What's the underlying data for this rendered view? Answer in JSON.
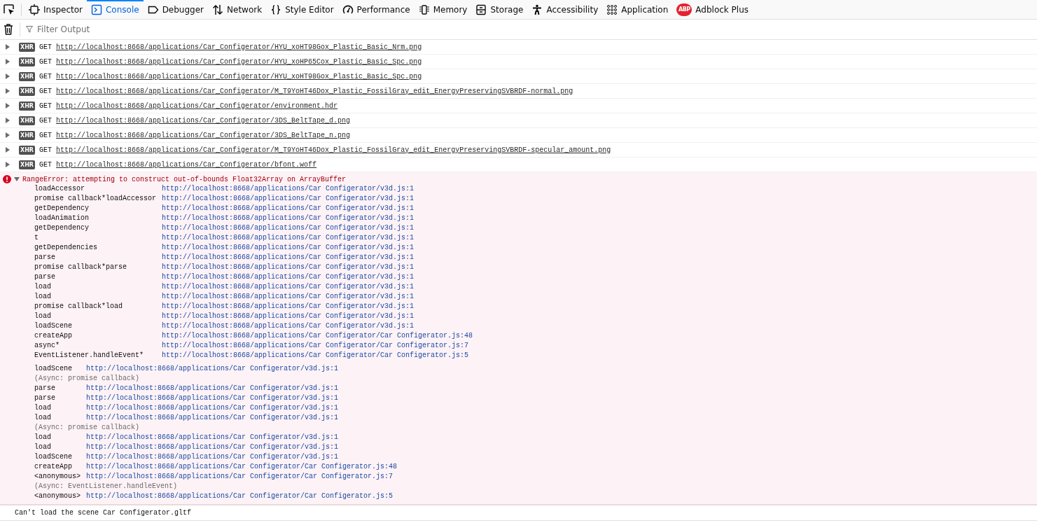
{
  "toolbar": {
    "tools": [
      {
        "label": "Inspector",
        "selected": false
      },
      {
        "label": "Console",
        "selected": true
      },
      {
        "label": "Debugger",
        "selected": false
      },
      {
        "label": "Network",
        "selected": false
      },
      {
        "label": "Style Editor",
        "selected": false
      },
      {
        "label": "Performance",
        "selected": false
      },
      {
        "label": "Memory",
        "selected": false
      },
      {
        "label": "Storage",
        "selected": false
      },
      {
        "label": "Accessibility",
        "selected": false
      },
      {
        "label": "Application",
        "selected": false
      },
      {
        "label": "Adblock Plus",
        "icon_text": "ABP",
        "selected": false
      }
    ]
  },
  "filter": {
    "placeholder": "Filter Output"
  },
  "messages": [
    {
      "kind": "request",
      "badge": "XHR",
      "method": "GET",
      "url": "http://localhost:8668/applications/Car_Configerator/HYU_xoHT98Gox_Plastic_Basic_Nrm.png"
    },
    {
      "kind": "request",
      "badge": "XHR",
      "method": "GET",
      "url": "http://localhost:8668/applications/Car_Configerator/HYU_xoHP65Cox_Plastic_Basic_Spc.png"
    },
    {
      "kind": "request",
      "badge": "XHR",
      "method": "GET",
      "url": "http://localhost:8668/applications/Car_Configerator/HYU_xoHT98Gox_Plastic_Basic_Spc.png"
    },
    {
      "kind": "request",
      "badge": "XHR",
      "method": "GET",
      "url": "http://localhost:8668/applications/Car_Configerator/M_T9YoHT46Dox_Plastic_FossilGray_edit_EnergyPreservingSVBRDF-normal.png"
    },
    {
      "kind": "request",
      "badge": "XHR",
      "method": "GET",
      "url": "http://localhost:8668/applications/Car_Configerator/environment.hdr"
    },
    {
      "kind": "request",
      "badge": "XHR",
      "method": "GET",
      "url": "http://localhost:8668/applications/Car_Configerator/3DS_BeltTape_d.png"
    },
    {
      "kind": "request",
      "badge": "XHR",
      "method": "GET",
      "url": "http://localhost:8668/applications/Car_Configerator/3DS_BeltTape_n.png"
    },
    {
      "kind": "request",
      "badge": "XHR",
      "method": "GET",
      "url": "http://localhost:8668/applications/Car_Configerator/M_T9YoHT46Dox_Plastic_FossilGray_edit_EnergyPreservingSVBRDF-specular_amount.png"
    },
    {
      "kind": "request",
      "badge": "XHR",
      "method": "GET",
      "url": "http://localhost:8668/applications/Car_Configerator/bfont.woff"
    },
    {
      "kind": "error",
      "expanded": true,
      "text": "RangeError: attempting to construct out-of-bounds Float32Array on ArrayBuffer",
      "stacks": [
        [
          {
            "kind": "frame",
            "fn": "loadAccessor",
            "src": "http://localhost:8668/applications/Car Configerator/v3d.js:1"
          },
          {
            "kind": "frame",
            "fn": "promise callback*loadAccessor",
            "src": "http://localhost:8668/applications/Car Configerator/v3d.js:1"
          },
          {
            "kind": "frame",
            "fn": "getDependency",
            "src": "http://localhost:8668/applications/Car Configerator/v3d.js:1"
          },
          {
            "kind": "frame",
            "fn": "loadAnimation",
            "src": "http://localhost:8668/applications/Car Configerator/v3d.js:1"
          },
          {
            "kind": "frame",
            "fn": "getDependency",
            "src": "http://localhost:8668/applications/Car Configerator/v3d.js:1"
          },
          {
            "kind": "frame",
            "fn": "t",
            "src": "http://localhost:8668/applications/Car Configerator/v3d.js:1"
          },
          {
            "kind": "frame",
            "fn": "getDependencies",
            "src": "http://localhost:8668/applications/Car Configerator/v3d.js:1"
          },
          {
            "kind": "frame",
            "fn": "parse",
            "src": "http://localhost:8668/applications/Car Configerator/v3d.js:1"
          },
          {
            "kind": "frame",
            "fn": "promise callback*parse",
            "src": "http://localhost:8668/applications/Car Configerator/v3d.js:1"
          },
          {
            "kind": "frame",
            "fn": "parse",
            "src": "http://localhost:8668/applications/Car Configerator/v3d.js:1"
          },
          {
            "kind": "frame",
            "fn": "load",
            "src": "http://localhost:8668/applications/Car Configerator/v3d.js:1"
          },
          {
            "kind": "frame",
            "fn": "load",
            "src": "http://localhost:8668/applications/Car Configerator/v3d.js:1"
          },
          {
            "kind": "frame",
            "fn": "promise callback*load",
            "src": "http://localhost:8668/applications/Car Configerator/v3d.js:1"
          },
          {
            "kind": "frame",
            "fn": "load",
            "src": "http://localhost:8668/applications/Car Configerator/v3d.js:1"
          },
          {
            "kind": "frame",
            "fn": "loadScene",
            "src": "http://localhost:8668/applications/Car Configerator/v3d.js:1"
          },
          {
            "kind": "frame",
            "fn": "createApp",
            "src": "http://localhost:8668/applications/Car Configerator/Car Configerator.js:48"
          },
          {
            "kind": "frame",
            "fn": "async*",
            "src": "http://localhost:8668/applications/Car Configerator/Car Configerator.js:7"
          },
          {
            "kind": "frame",
            "fn": "EventListener.handleEvent*",
            "src": "http://localhost:8668/applications/Car Configerator/Car Configerator.js:5"
          }
        ],
        [
          {
            "kind": "frame",
            "fn": "loadScene",
            "src": "http://localhost:8668/applications/Car Configerator/v3d.js:1"
          },
          {
            "kind": "async",
            "text": "(Async: promise callback)"
          },
          {
            "kind": "frame",
            "fn": "parse",
            "src": "http://localhost:8668/applications/Car Configerator/v3d.js:1"
          },
          {
            "kind": "frame",
            "fn": "parse",
            "src": "http://localhost:8668/applications/Car Configerator/v3d.js:1"
          },
          {
            "kind": "frame",
            "fn": "load",
            "src": "http://localhost:8668/applications/Car Configerator/v3d.js:1"
          },
          {
            "kind": "frame",
            "fn": "load",
            "src": "http://localhost:8668/applications/Car Configerator/v3d.js:1"
          },
          {
            "kind": "async",
            "text": "(Async: promise callback)"
          },
          {
            "kind": "frame",
            "fn": "load",
            "src": "http://localhost:8668/applications/Car Configerator/v3d.js:1"
          },
          {
            "kind": "frame",
            "fn": "load",
            "src": "http://localhost:8668/applications/Car Configerator/v3d.js:1"
          },
          {
            "kind": "frame",
            "fn": "loadScene",
            "src": "http://localhost:8668/applications/Car Configerator/v3d.js:1"
          },
          {
            "kind": "frame",
            "fn": "createApp",
            "src": "http://localhost:8668/applications/Car Configerator/Car Configerator.js:48"
          },
          {
            "kind": "frame",
            "fn": "<anonymous>",
            "src": "http://localhost:8668/applications/Car Configerator/Car Configerator.js:7"
          },
          {
            "kind": "async",
            "text": "(Async: EventListener.handleEvent)"
          },
          {
            "kind": "frame",
            "fn": "<anonymous>",
            "src": "http://localhost:8668/applications/Car Configerator/Car Configerator.js:5"
          }
        ]
      ]
    },
    {
      "kind": "log",
      "text": "Can't load the scene Car Configerator.gltf"
    }
  ]
}
